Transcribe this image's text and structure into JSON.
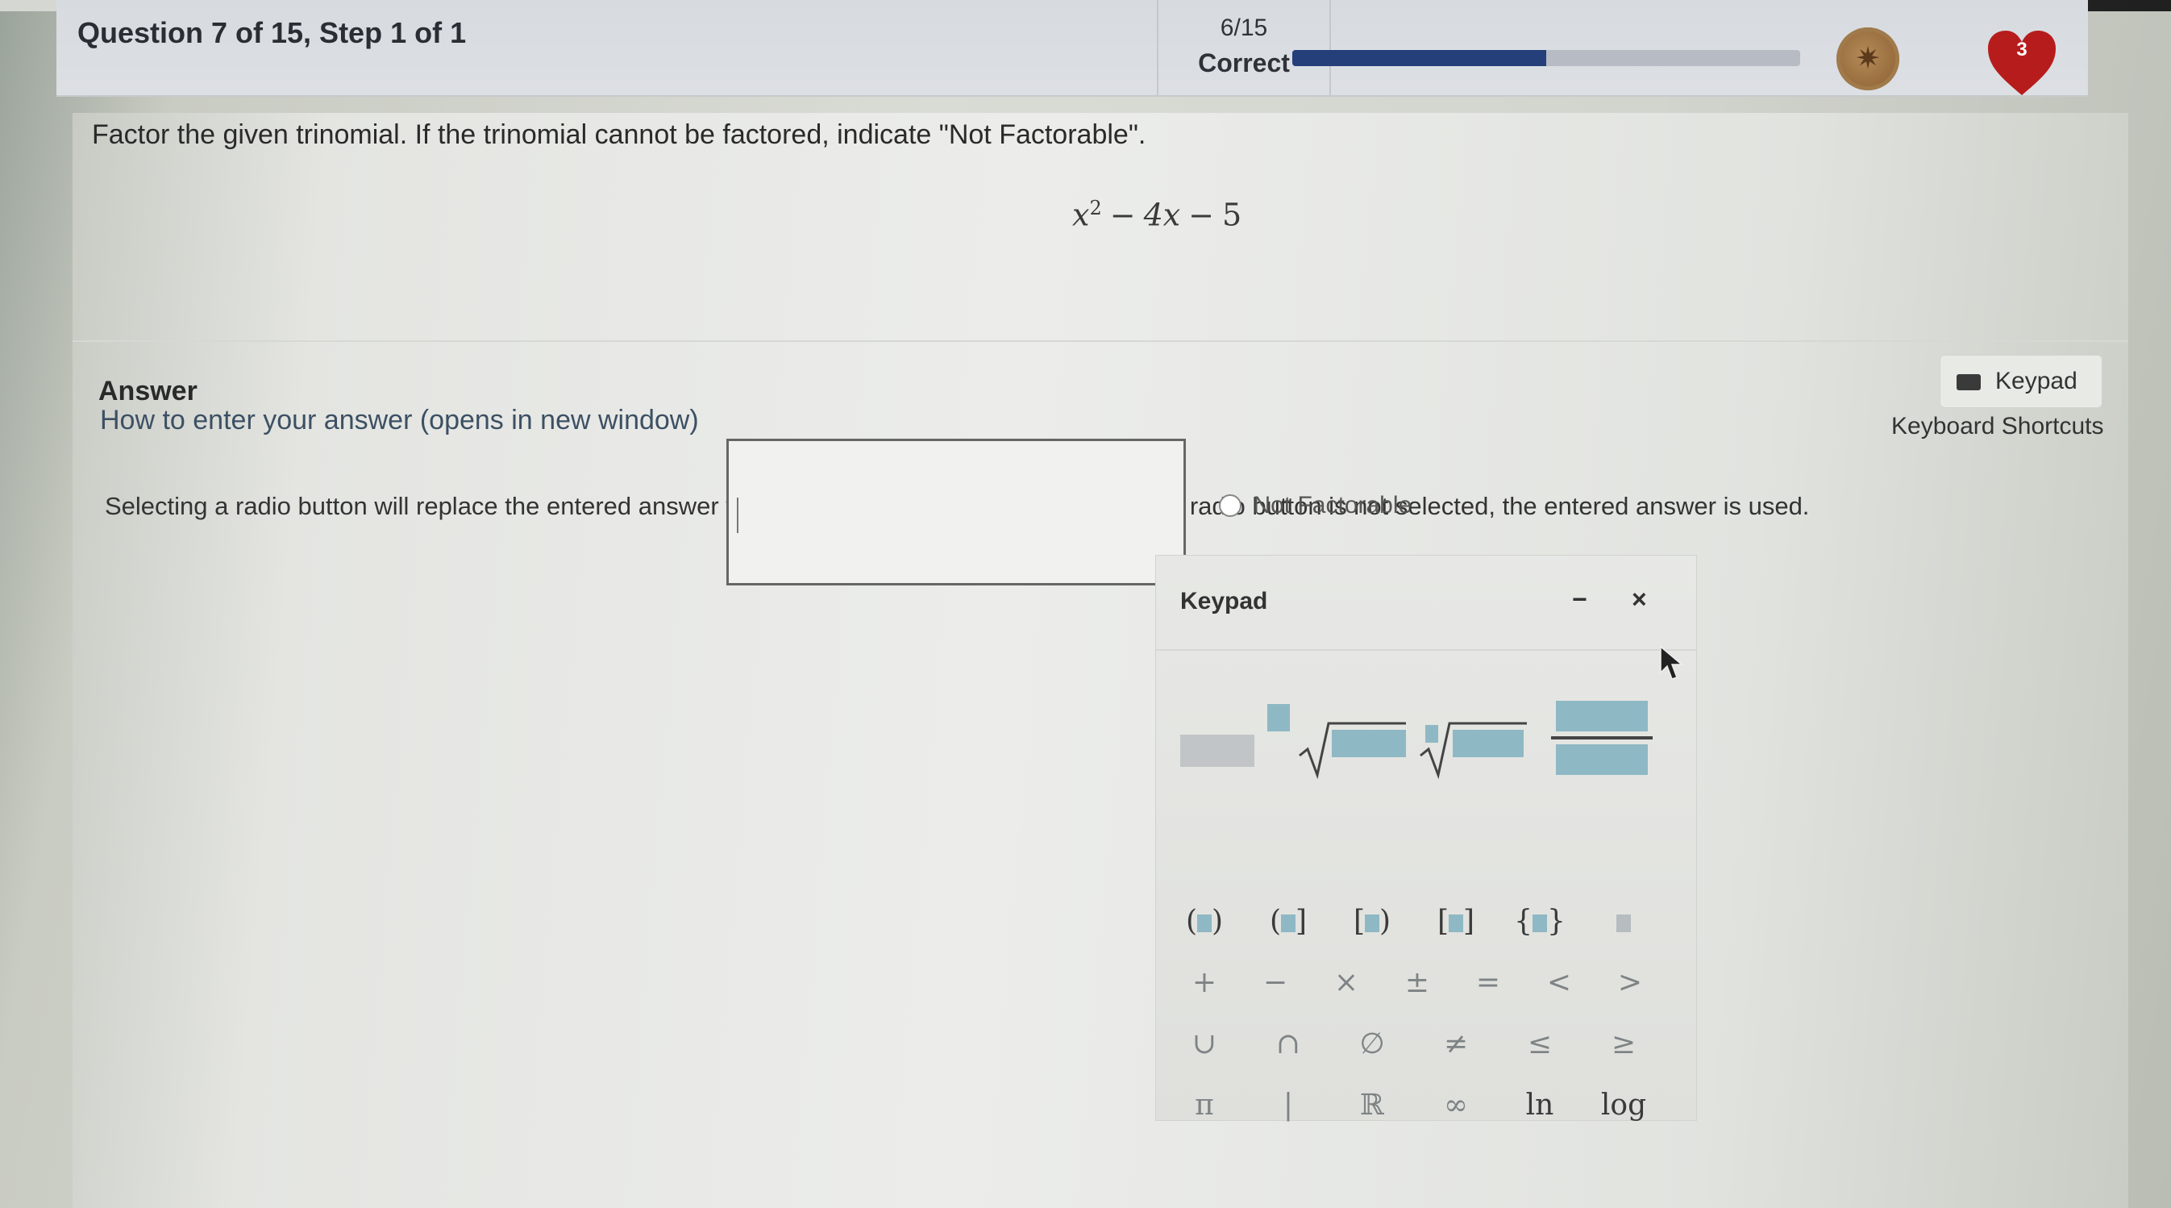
{
  "header": {
    "question_title": "Question 7 of 15, Step 1 of 1",
    "score_fraction": "6/15",
    "score_label": "Correct",
    "progress": 0.5,
    "hearts_count": "3"
  },
  "question": {
    "prompt": "Factor the given trinomial. If the trinomial cannot be factored, indicate \"Not Factorable\".",
    "expression": {
      "var": "x",
      "exp": "2",
      "minus1": "−",
      "term2": "4x",
      "minus2": "−",
      "constant": "5"
    }
  },
  "answer": {
    "label": "Answer",
    "howto_link": "How to enter your answer (opens in new window)",
    "keypad_button": "Keypad",
    "shortcuts_link": "Keyboard Shortcuts",
    "radio_note": "Selecting a radio button will replace the entered answer value(s) with the radio button value. If the radio button is not selected, the entered answer is used.",
    "input_value": "",
    "radio_label": "Not Factorable"
  },
  "keypad": {
    "title": "Keypad",
    "minimize": "−",
    "close": "×",
    "row_symbols_1": [
      "+",
      "−",
      "×",
      "±",
      "=",
      "<",
      ">"
    ],
    "row_symbols_2": [
      "∪",
      "∩",
      "∅",
      "≠",
      "≤",
      "≥"
    ],
    "row_symbols_3": [
      "π",
      "|",
      "ℝ",
      "∞",
      "ln",
      "log"
    ]
  },
  "colors": {
    "accent": "#243f7a",
    "template_blue": "#8fb8c5",
    "heart_red": "#b71c1c"
  }
}
